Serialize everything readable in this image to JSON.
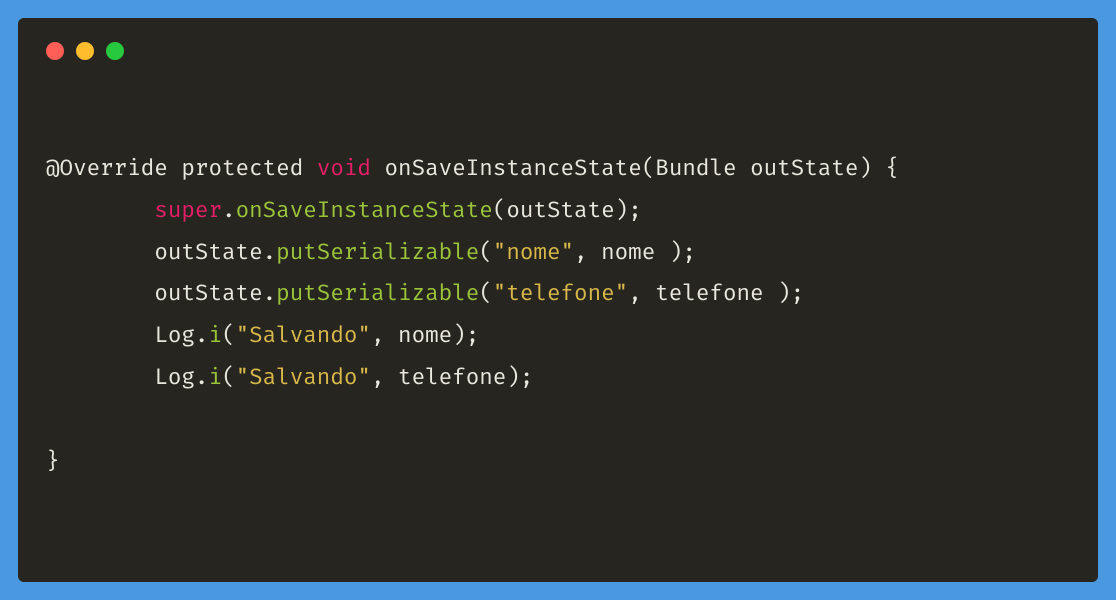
{
  "window": {
    "controls": {
      "red": "close",
      "yellow": "minimize",
      "green": "maximize"
    }
  },
  "code": {
    "line1": {
      "annotation": "@Override",
      "modifier": "protected",
      "returnType": "void",
      "methodName": "onSaveInstanceState",
      "paramType": "Bundle",
      "paramName": "outState",
      "open": "{"
    },
    "line2": {
      "indent": "        ",
      "super": "super",
      "dot": ".",
      "method": "onSaveInstanceState",
      "open": "(",
      "arg": "outState",
      "close": ");"
    },
    "line3": {
      "indent": "        ",
      "obj": "outState.",
      "method": "putSerializable",
      "open": "(",
      "str": "\"nome\"",
      "comma": ", ",
      "arg": "nome ",
      "close": ");"
    },
    "line4": {
      "indent": "        ",
      "obj": "outState.",
      "method": "putSerializable",
      "open": "(",
      "str": "\"telefone\"",
      "comma": ", ",
      "arg": "telefone ",
      "close": ");"
    },
    "line5": {
      "indent": "        ",
      "obj": "Log.",
      "method": "i",
      "open": "(",
      "str": "\"Salvando\"",
      "comma": ", ",
      "arg": "nome",
      "close": ");"
    },
    "line6": {
      "indent": "        ",
      "obj": "Log.",
      "method": "i",
      "open": "(",
      "str": "\"Salvando\"",
      "comma": ", ",
      "arg": "telefone",
      "close": ");"
    },
    "line8": {
      "close": "}"
    }
  }
}
